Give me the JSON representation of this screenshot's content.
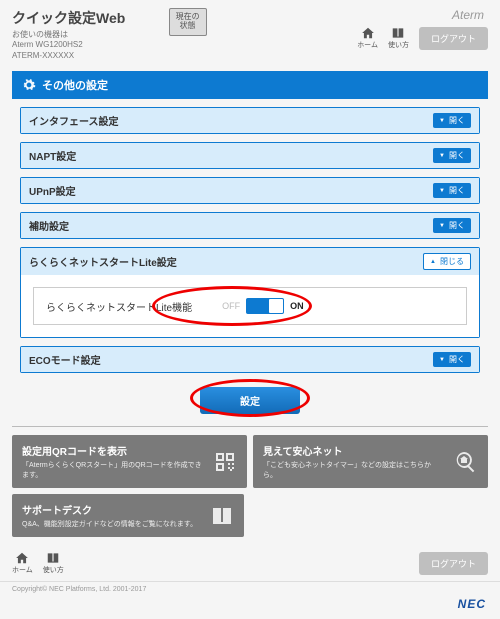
{
  "header": {
    "title": "クイック設定Web",
    "subtitle_line1": "お使いの機器は",
    "model1": "Aterm WG1200HS2",
    "model2": "ATERM-XXXXXX",
    "status_btn_l1": "現在の",
    "status_btn_l2": "状態",
    "brand": "Aterm",
    "home": "ホーム",
    "howto": "使い方",
    "logout": "ログアウト"
  },
  "section_title": "その他の設定",
  "panels": {
    "interface": "インタフェース設定",
    "napt": "NAPT設定",
    "upnp": "UPnP設定",
    "aux": "補助設定",
    "rakuraku": "らくらくネットスタートLite設定",
    "eco": "ECOモード設定",
    "open": "開く",
    "close": "閉じる"
  },
  "toggle": {
    "label": "らくらくネットスタートLite機能",
    "off": "OFF",
    "on": "ON"
  },
  "submit": "設定",
  "cards": {
    "qr_title": "設定用QRコードを表示",
    "qr_desc": "「AtermらくらくQRスタート」用のQRコードを作成できます。",
    "safety_title": "見えて安心ネット",
    "safety_desc": "「こども安心ネットタイマー」などの設定はこちらから。",
    "support_title": "サポートデスク",
    "support_desc": "Q&A、機能別設定ガイドなどの情報をご覧になれます。"
  },
  "copyright": "Copyright© NEC Platforms, Ltd. 2001-2017",
  "nec": "NEC"
}
